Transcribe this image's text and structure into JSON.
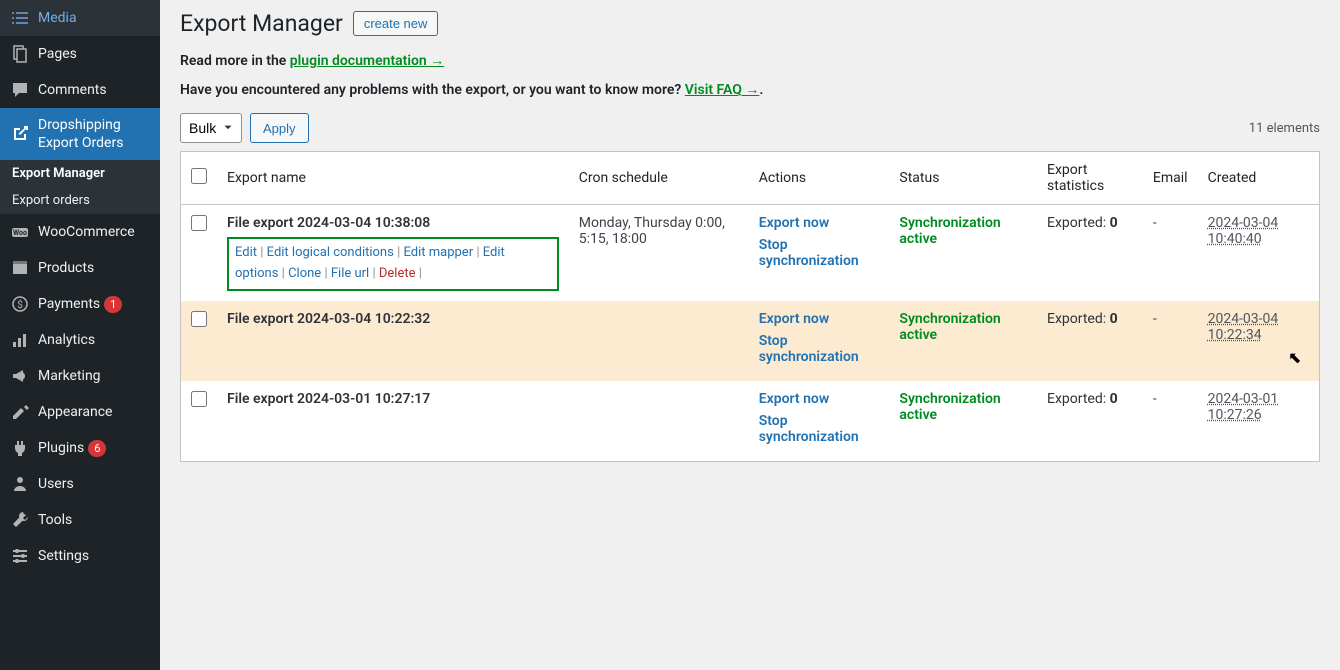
{
  "sidebar": {
    "items": [
      {
        "icon": "media",
        "label": "Media"
      },
      {
        "icon": "pages",
        "label": "Pages"
      },
      {
        "icon": "comments",
        "label": "Comments"
      },
      {
        "icon": "export",
        "label": "Dropshipping Export Orders",
        "active": true
      },
      {
        "icon": "woo",
        "label": "WooCommerce"
      },
      {
        "icon": "products",
        "label": "Products"
      },
      {
        "icon": "payments",
        "label": "Payments",
        "badge": "1"
      },
      {
        "icon": "analytics",
        "label": "Analytics"
      },
      {
        "icon": "marketing",
        "label": "Marketing"
      },
      {
        "icon": "appearance",
        "label": "Appearance"
      },
      {
        "icon": "plugins",
        "label": "Plugins",
        "badge": "6"
      },
      {
        "icon": "users",
        "label": "Users"
      },
      {
        "icon": "tools",
        "label": "Tools"
      },
      {
        "icon": "settings",
        "label": "Settings"
      }
    ],
    "submenu": [
      {
        "label": "Export Manager",
        "active": true
      },
      {
        "label": "Export orders"
      }
    ]
  },
  "header": {
    "title": "Export Manager",
    "create": "create new"
  },
  "notice1_prefix": "Read more in the ",
  "notice1_link": "plugin documentation →",
  "notice2_prefix": "Have you encountered any problems with the export, or you want to know more? ",
  "notice2_link": "Visit FAQ →",
  "notice2_suffix": ".",
  "toolbar": {
    "bulk": "Bulk",
    "apply": "Apply",
    "count": "11 elements"
  },
  "columns": [
    "Export name",
    "Cron schedule",
    "Actions",
    "Status",
    "Export statistics",
    "Email",
    "Created"
  ],
  "actions": {
    "export_now": "Export now",
    "stop_sync": "Stop synchronization"
  },
  "status_label": "Synchronization active",
  "exported_label": "Exported: ",
  "row_actions": {
    "edit": "Edit",
    "edit_logical": "Edit logical conditions",
    "edit_mapper": "Edit mapper",
    "edit_options": "Edit options",
    "clone": "Clone",
    "file_url": "File url",
    "delete": "Delete"
  },
  "rows": [
    {
      "name": "File export 2024-03-04 10:38:08",
      "cron": "Monday, Thursday 0:00, 5:15, 18:00",
      "exported": "0",
      "email": "-",
      "created": "2024-03-04 10:40:40",
      "show_actions": true
    },
    {
      "name": "File export 2024-03-04 10:22:32",
      "cron": "",
      "exported": "0",
      "email": "-",
      "created": "2024-03-04 10:22:34",
      "highlight": true
    },
    {
      "name": "File export 2024-03-01 10:27:17",
      "cron": "",
      "exported": "0",
      "email": "-",
      "created": "2024-03-01 10:27:26"
    }
  ]
}
